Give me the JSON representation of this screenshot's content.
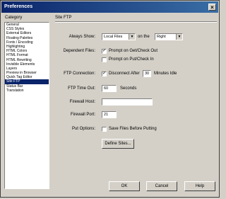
{
  "window": {
    "title": "Preferences",
    "close_glyph": "×"
  },
  "category": {
    "label": "Category",
    "items": [
      "General",
      "CSS Styles",
      "External Editors",
      "Floating Palettes",
      "Fonts / Encoding",
      "Highlighting",
      "HTML Colors",
      "HTML Format",
      "HTML Rewriting",
      "Invisible Elements",
      "Layers",
      "Preview in Browser",
      "Quick Tag Editor",
      "Site FTP",
      "Status Bar",
      "Translation"
    ],
    "selected_index": 13
  },
  "panel": {
    "title": "Site FTP",
    "always_show_label": "Always Show:",
    "always_show_value": "Local Files",
    "on_the_label": "on the",
    "on_the_value": "Right",
    "dependent_files_label": "Dependent Files:",
    "prompt_get_label": "Prompt on Get/Check Out",
    "prompt_put_label": "Prompt on Put/Check In",
    "ftp_connection_label": "FTP Connection:",
    "disconnect_label": "Disconnect After",
    "disconnect_minutes": "30",
    "minutes_idle_label": "Minutes Idle",
    "ftp_timeout_label": "FTP Time Out:",
    "ftp_timeout_value": "60",
    "seconds_label": "Seconds",
    "firewall_host_label": "Firewall Host:",
    "firewall_host_value": "",
    "firewall_port_label": "Firewall Port:",
    "firewall_port_value": "21",
    "put_options_label": "Put Options:",
    "save_files_label": "Save Files Before Putting",
    "define_sites_label": "Define Sites..."
  },
  "buttons": {
    "ok": "OK",
    "cancel": "Cancel",
    "help": "Help"
  },
  "checks": {
    "prompt_get": true,
    "prompt_put": false,
    "disconnect": true,
    "save_files": false
  }
}
